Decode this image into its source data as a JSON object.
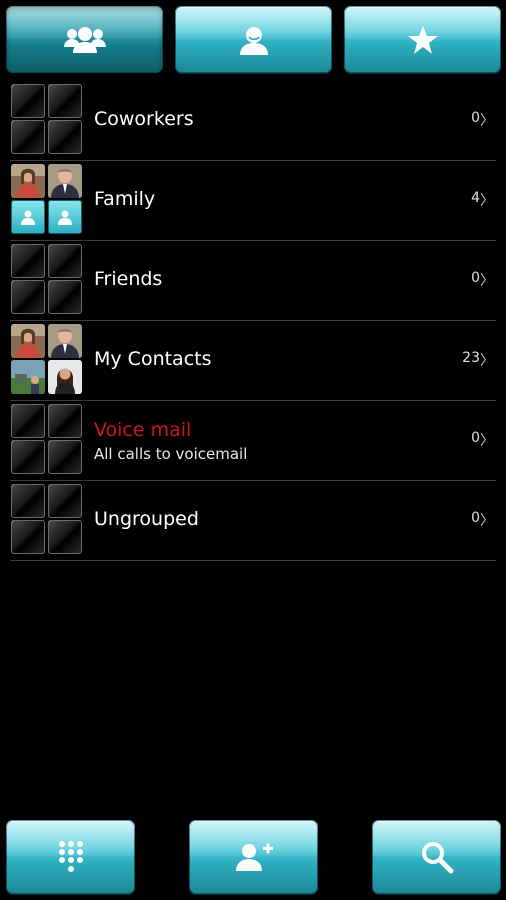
{
  "tabs": [
    {
      "icon": "groups-icon",
      "active": true
    },
    {
      "icon": "contact-icon",
      "active": false
    },
    {
      "icon": "star-icon",
      "active": false
    }
  ],
  "groups": [
    {
      "name": "Coworkers",
      "count": "0",
      "subtitle": "",
      "thumbs": "empty"
    },
    {
      "name": "Family",
      "count": "4",
      "subtitle": "",
      "thumbs": "photos-family"
    },
    {
      "name": "Friends",
      "count": "0",
      "subtitle": "",
      "thumbs": "empty"
    },
    {
      "name": "My Contacts",
      "count": "23",
      "subtitle": "",
      "thumbs": "photos-contacts"
    },
    {
      "name": "Voice mail",
      "count": "0",
      "subtitle": "All calls to voicemail",
      "thumbs": "empty"
    },
    {
      "name": "Ungrouped",
      "count": "0",
      "subtitle": "",
      "thumbs": "empty"
    }
  ],
  "chevron": "〉",
  "toolbar": [
    {
      "icon": "dialpad-icon"
    },
    {
      "icon": "add-contact-icon"
    },
    {
      "icon": "search-icon"
    }
  ],
  "colors": {
    "accent": "#2fb0c2",
    "voicemail_title": "#c8181c",
    "divider": "#3a3a3a"
  }
}
